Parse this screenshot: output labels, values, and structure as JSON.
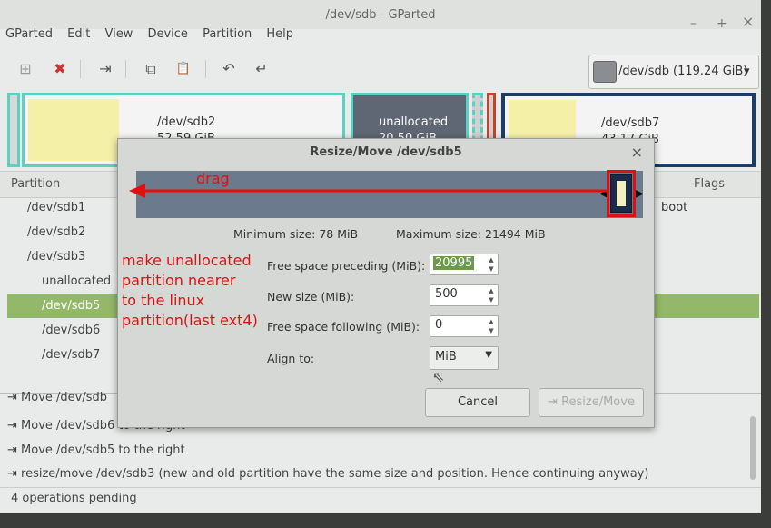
{
  "window": {
    "title": "/dev/sdb - GParted",
    "minimize": "–",
    "maximize": "+",
    "close": "×"
  },
  "menu": [
    "GParted",
    "Edit",
    "View",
    "Device",
    "Partition",
    "Help"
  ],
  "toolbar": {
    "new": "⊞",
    "delete": "✖",
    "resize": "⇥",
    "copy": "⧉",
    "paste": "📋",
    "undo": "↶",
    "apply": "↵"
  },
  "device": {
    "name": "/dev/sdb",
    "size": "(119.24 GiB)",
    "arrow": "▾"
  },
  "graph": [
    {
      "name": "/dev/sdb2",
      "size": "52.59 GiB"
    },
    {
      "name": "unallocated",
      "size": "20.50 GiB"
    },
    {
      "name": "/dev/sdb7",
      "size": "43.17 GiB"
    }
  ],
  "columns": {
    "partition": "Partition",
    "flags": "Flags"
  },
  "partitions": [
    {
      "name": "/dev/sdb1",
      "flags": "boot"
    },
    {
      "name": "/dev/sdb2",
      "flags": ""
    },
    {
      "name": "/dev/sdb3",
      "flags": ""
    },
    {
      "name": "unallocated",
      "flags": ""
    },
    {
      "name": "/dev/sdb5",
      "flags": ""
    },
    {
      "name": "/dev/sdb6",
      "flags": ""
    },
    {
      "name": "/dev/sdb7",
      "flags": ""
    }
  ],
  "operations": [
    "Move /dev/sdb6 to the right",
    "Move /dev/sdb5 to the right",
    "resize/move /dev/sdb3 (new and old partition have the same size and position.  Hence continuing anyway)"
  ],
  "ops_partial": "Move /dev/sdb",
  "status": "4 operations pending",
  "dialog": {
    "title": "Resize/Move /dev/sdb5",
    "close": "×",
    "min_size": "Minimum size: 78 MiB",
    "max_size": "Maximum size: 21494 MiB",
    "preceding_label": "Free space preceding (MiB):",
    "preceding_value": "20995",
    "newsize_label": "New size (MiB):",
    "newsize_value": "500",
    "following_label": "Free space following (MiB):",
    "following_value": "0",
    "align_label": "Align to:",
    "align_value": "MiB",
    "cancel": "Cancel",
    "resize": "Resize/Move"
  },
  "annotations": {
    "drag": "drag",
    "note_line1": "make unallocated",
    "note_line2": "partition nearer",
    "note_line3": "to the linux",
    "note_line4": "partition(last ext4)"
  },
  "colors": {
    "accent_red": "#e01010",
    "selection_green": "#94b86a",
    "bar_blue": "#6b7a8d"
  }
}
